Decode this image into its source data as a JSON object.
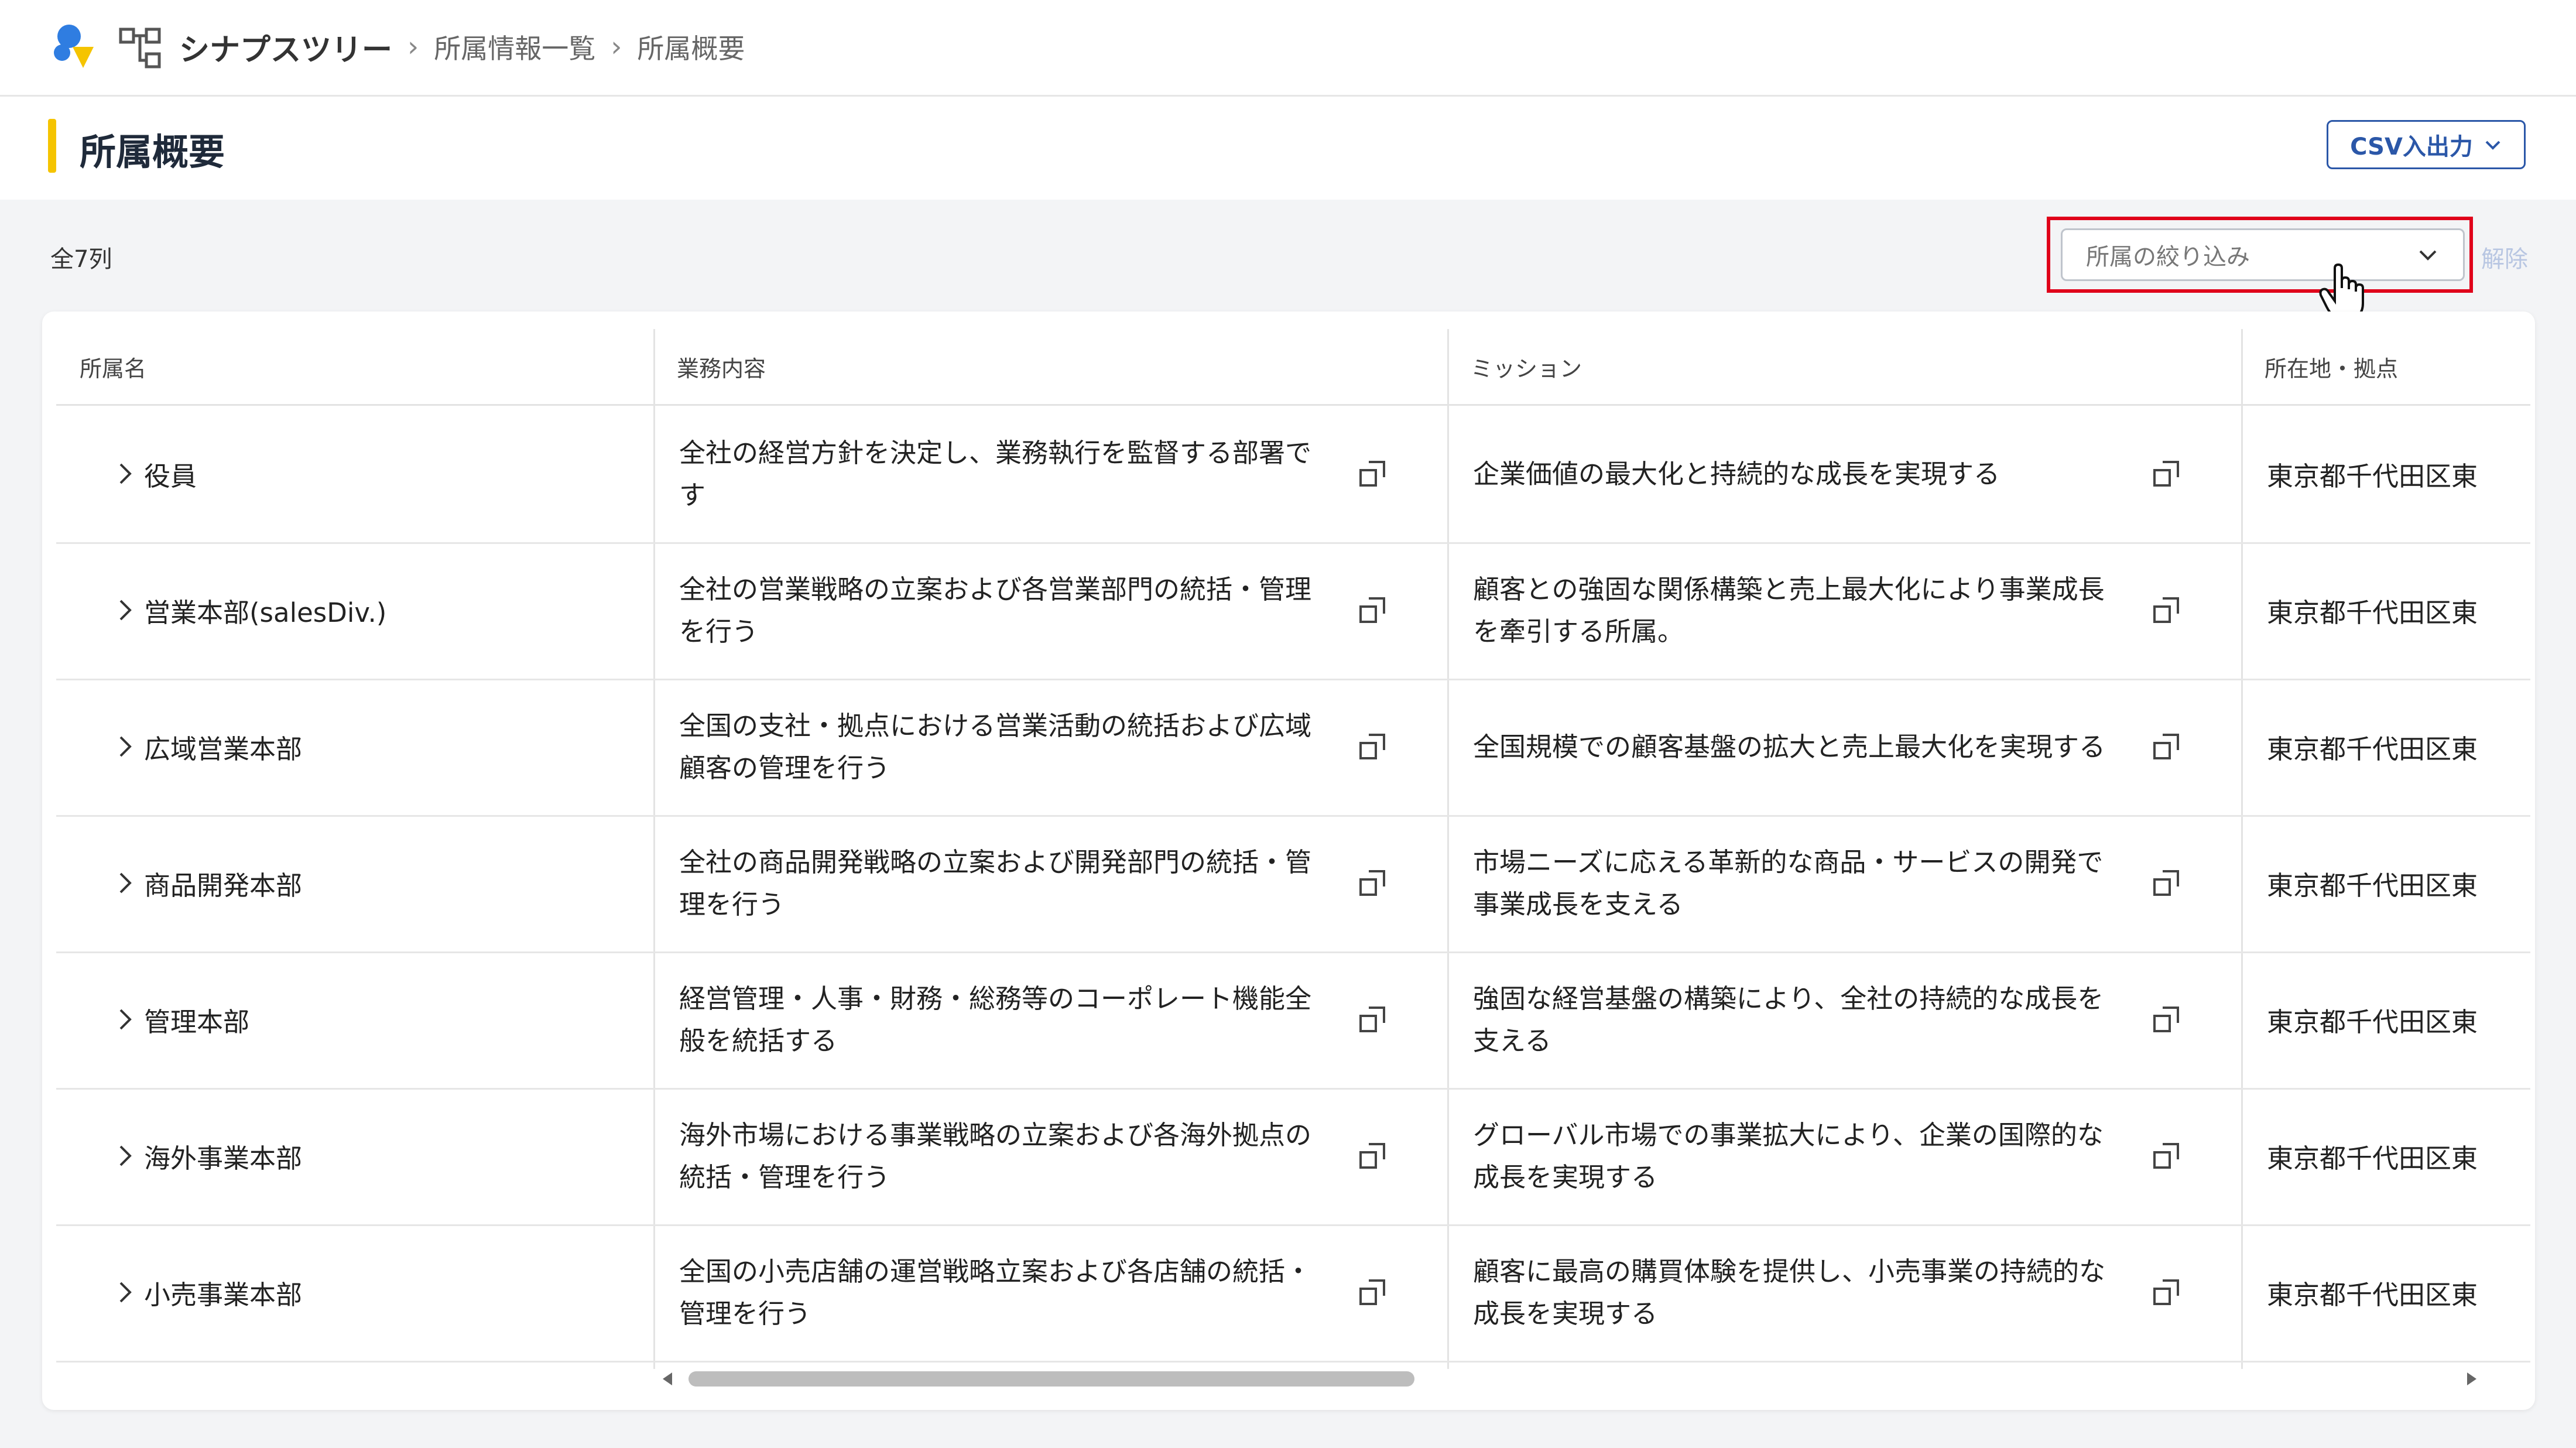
{
  "breadcrumb": {
    "app_name": "シナプスツリー",
    "items": [
      "所属情報一覧",
      "所属概要"
    ]
  },
  "page": {
    "title": "所属概要",
    "csv_button": "CSV入出力"
  },
  "toolbar": {
    "column_count": "全7列",
    "filter_placeholder": "所属の絞り込み",
    "clear_label": "解除"
  },
  "table": {
    "headers": [
      "所属名",
      "業務内容",
      "ミッション",
      "所在地・拠点"
    ],
    "rows": [
      {
        "name": "役員",
        "business": "全社の経営方針を決定し、業務執行を監督する部署です",
        "mission": "企業価値の最大化と持続的な成長を実現する",
        "location": "東京都千代田区東"
      },
      {
        "name": "営業本部(salesDiv.)",
        "business": "全社の営業戦略の立案および各営業部門の統括・管理を行う",
        "mission": "顧客との強固な関係構築と売上最大化により事業成長を牽引する所属。",
        "location": "東京都千代田区東"
      },
      {
        "name": "広域営業本部",
        "business": "全国の支社・拠点における営業活動の統括および広域顧客の管理を行う",
        "mission": "全国規模での顧客基盤の拡大と売上最大化を実現する",
        "location": "東京都千代田区東"
      },
      {
        "name": "商品開発本部",
        "business": "全社の商品開発戦略の立案および開発部門の統括・管理を行う",
        "mission": "市場ニーズに応える革新的な商品・サービスの開発で事業成長を支える",
        "location": "東京都千代田区東"
      },
      {
        "name": "管理本部",
        "business": "経営管理・人事・財務・総務等のコーポレート機能全般を統括する",
        "mission": "強固な経営基盤の構築により、全社の持続的な成長を支える",
        "location": "東京都千代田区東"
      },
      {
        "name": "海外事業本部",
        "business": "海外市場における事業戦略の立案および各海外拠点の統括・管理を行う",
        "mission": "グローバル市場での事業拡大により、企業の国際的な成長を実現する",
        "location": "東京都千代田区東"
      },
      {
        "name": "小売事業本部",
        "business": "全国の小売店舗の運営戦略立案および各店舗の統括・管理を行う",
        "mission": "顧客に最高の購買体験を提供し、小売事業の持続的な成長を実現する",
        "location": "東京都千代田区東"
      }
    ]
  },
  "colors": {
    "accent_yellow": "#f5c400",
    "primary_blue": "#2b57a8",
    "highlight_red": "#e0001a"
  }
}
